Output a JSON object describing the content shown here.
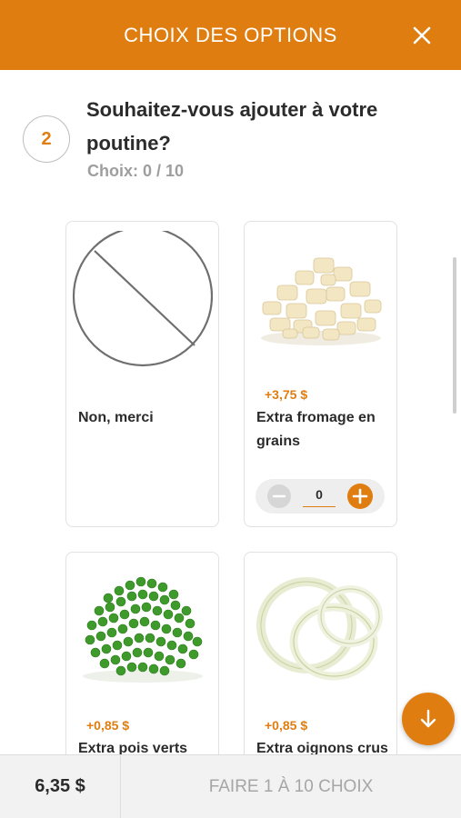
{
  "header": {
    "title": "CHOIX DES OPTIONS",
    "close_icon": "close-icon"
  },
  "step": {
    "number": "2",
    "question": "Souhaitez-vous ajouter à votre poutine?",
    "choices_label": "Choix: 0 / 10"
  },
  "options": [
    {
      "name": "Non, merci",
      "price": "",
      "image": "no-symbol-icon"
    },
    {
      "name": "Extra fromage en grains",
      "price": "+3,75 $",
      "image": "cheese-curds-image",
      "quantity": "0"
    },
    {
      "name": "Extra pois verts",
      "price": "+0,85 $",
      "image": "green-peas-image"
    },
    {
      "name": "Extra oignons crus",
      "price": "+0,85 $",
      "image": "onion-rings-image"
    }
  ],
  "footer": {
    "total": "6,35 $",
    "cta_label": "FAIRE 1 À 10 CHOIX"
  },
  "colors": {
    "accent": "#e07d10",
    "muted_text": "#9e9e9e",
    "footer_bg": "#f2f2f2"
  }
}
